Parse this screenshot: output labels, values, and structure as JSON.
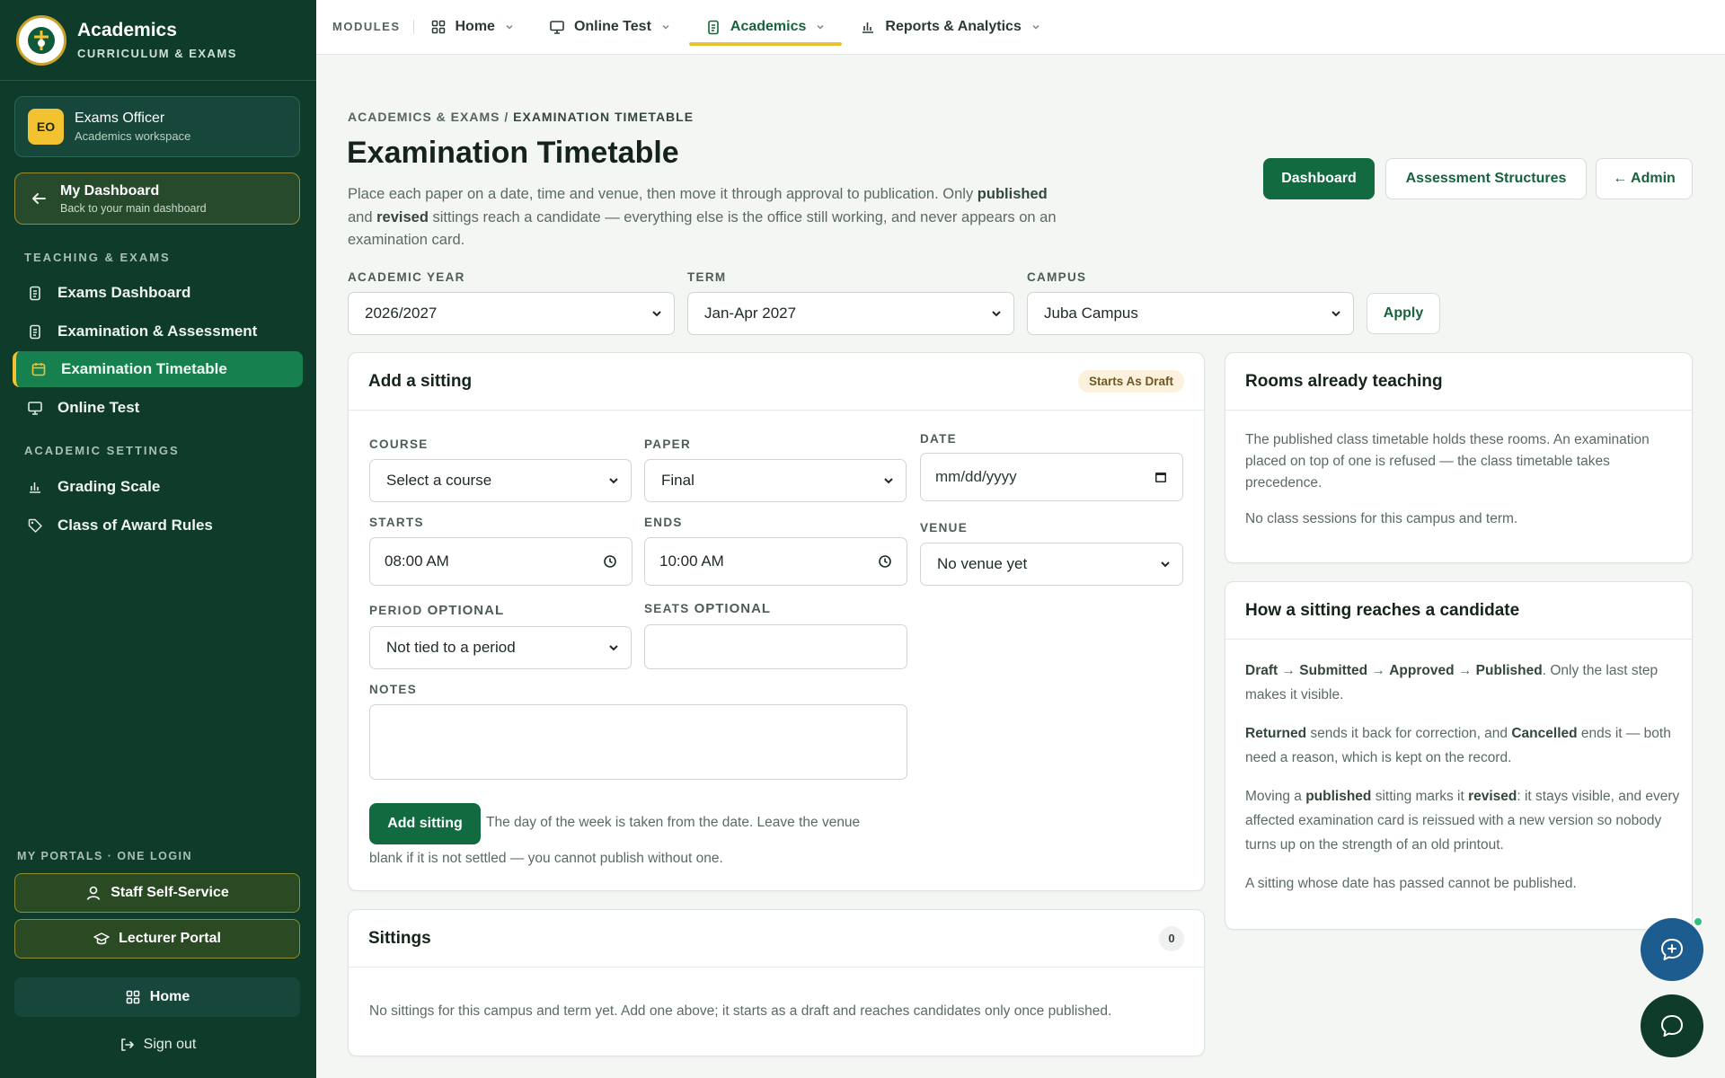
{
  "sidebar": {
    "brand_title": "Academics",
    "brand_sub": "CURRICULUM & EXAMS",
    "user": {
      "initials": "EO",
      "name": "Exams Officer",
      "sub": "Academics workspace"
    },
    "dashboard": {
      "title": "My Dashboard",
      "sub": "Back to your main dashboard"
    },
    "section_teaching": "TEACHING & EXAMS",
    "teaching_items": [
      {
        "label": "Exams Dashboard"
      },
      {
        "label": "Examination & Assessment"
      },
      {
        "label": "Examination Timetable"
      },
      {
        "label": "Online Test"
      }
    ],
    "section_settings": "ACADEMIC SETTINGS",
    "settings_items": [
      {
        "label": "Grading Scale"
      },
      {
        "label": "Class of Award Rules"
      }
    ],
    "portals_label": "MY PORTALS · ONE LOGIN",
    "portal_staff": "Staff Self-Service",
    "portal_lecturer": "Lecturer Portal",
    "home": "Home",
    "signout": "Sign out"
  },
  "topbar": {
    "modules": "MODULES",
    "items": [
      {
        "label": "Home"
      },
      {
        "label": "Online Test"
      },
      {
        "label": "Academics"
      },
      {
        "label": "Reports & Analytics"
      }
    ]
  },
  "header": {
    "crumb_parent": "ACADEMICS & EXAMS",
    "crumb_sep": " / ",
    "crumb_current": "EXAMINATION TIMETABLE",
    "title": "Examination Timetable",
    "desc_1": "Place each paper on a date, time and venue, then move it through approval to publication. Only ",
    "desc_b1": "published",
    "desc_2": " and ",
    "desc_b2": "revised",
    "desc_3": " sittings reach a candidate — everything else is the office still working, and never appears on an examination card.",
    "btn_dashboard": "Dashboard",
    "btn_structures": "Assessment Structures",
    "btn_admin": "← Admin"
  },
  "filters": {
    "year_label": "ACADEMIC YEAR",
    "year_value": "2026/2027",
    "term_label": "TERM",
    "term_value": "Jan-Apr 2027",
    "campus_label": "CAMPUS",
    "campus_value": "Juba Campus",
    "apply": "Apply"
  },
  "add_sitting": {
    "title": "Add a sitting",
    "badge": "Starts As Draft",
    "course_label": "COURSE",
    "course_value": "Select a course",
    "paper_label": "PAPER",
    "paper_value": "Final",
    "date_label": "DATE",
    "date_value": "mm/dd/yyyy",
    "starts_label": "STARTS",
    "starts_value": "08:00 AM",
    "ends_label": "ENDS",
    "ends_value": "10:00 AM",
    "venue_label": "VENUE",
    "venue_value": "No venue yet",
    "period_label": "PERIOD",
    "period_opt": "OPTIONAL",
    "period_value": "Not tied to a period",
    "seats_label": "SEATS",
    "seats_opt": "OPTIONAL",
    "notes_label": "NOTES",
    "submit": "Add sitting",
    "hint_1": "The day of the week is taken from the date. Leave the venue",
    "hint_2": "blank if it is not settled — you cannot publish without one."
  },
  "sittings": {
    "title": "Sittings",
    "count": "0",
    "empty": "No sittings for this campus and term yet. Add one above; it starts as a draft and reaches candidates only once published."
  },
  "rooms": {
    "title": "Rooms already teaching",
    "p1": "The published class timetable holds these rooms. An examination placed on top of one is refused — the class timetable takes precedence.",
    "p2": "No class sessions for this campus and term."
  },
  "howto": {
    "title": "How a sitting reaches a candidate",
    "s_draft": "Draft",
    "s_submitted": "Submitted",
    "s_approved": "Approved",
    "s_published": "Published",
    "arrow": " → ",
    "l1_end": ". Only the last step makes it visible.",
    "returned": "Returned",
    "l2_a": " sends it back for correction, and ",
    "cancelled": "Cancelled",
    "l2_b": " ends it — both need a reason, which is kept on the record.",
    "l3_a": "Moving a ",
    "published": "published",
    "l3_b": " sitting marks it ",
    "revised": "revised",
    "l3_c": ": it stays visible, and every affected examination card is reissued with a new version so nobody turns up on the strength of an old printout.",
    "l4": "A sitting whose date has passed cannot be published."
  },
  "icons": {
    "chat_assist": "chat-plus-icon",
    "chat": "chat-icon"
  },
  "colors": {
    "sidebar": "#0f3b2a",
    "accent": "#116a40",
    "highlight": "#f2c230"
  }
}
